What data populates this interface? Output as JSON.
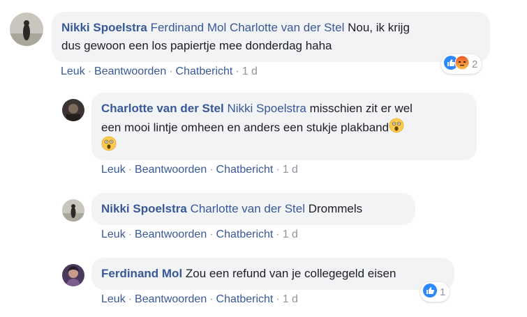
{
  "comments": [
    {
      "author": "Nikki Spoelstra",
      "tags": "Ferdinand Mol Charlotte van der Stel",
      "line1": "Nou, ik krijg",
      "line2": "dus gewoon een los papiertje mee donderdag haha",
      "actions": {
        "like": "Leuk",
        "reply": "Beantwoorden",
        "chat": "Chatbericht",
        "time": "1 d"
      },
      "reactions": {
        "icons": [
          "like-icon",
          "angry-icon"
        ],
        "count": "2"
      }
    },
    {
      "author": "Charlotte van der Stel",
      "tags": "Nikki Spoelstra",
      "line1": "misschien zit er wel",
      "line2": "een mooi lintje omheen en anders een stukje plakband",
      "emoji": "shocked-face-emoji",
      "actions": {
        "like": "Leuk",
        "reply": "Beantwoorden",
        "chat": "Chatbericht",
        "time": "1 d"
      }
    },
    {
      "author": "Nikki Spoelstra",
      "tags": "Charlotte van der Stel",
      "line1": "Drommels",
      "actions": {
        "like": "Leuk",
        "reply": "Beantwoorden",
        "chat": "Chatbericht",
        "time": "1 d"
      }
    },
    {
      "author": "Ferdinand Mol",
      "line1": "Zou een refund van je collegegeld eisen",
      "actions": {
        "like": "Leuk",
        "reply": "Beantwoorden",
        "chat": "Chatbericht",
        "time": "1 d"
      },
      "reactions": {
        "icons": [
          "like-icon"
        ],
        "count": "1"
      }
    }
  ],
  "separator": "·",
  "colors": {
    "link": "#385898",
    "bubble": "#f2f3f5",
    "like": "#2d88ff",
    "meta": "#90949c"
  }
}
